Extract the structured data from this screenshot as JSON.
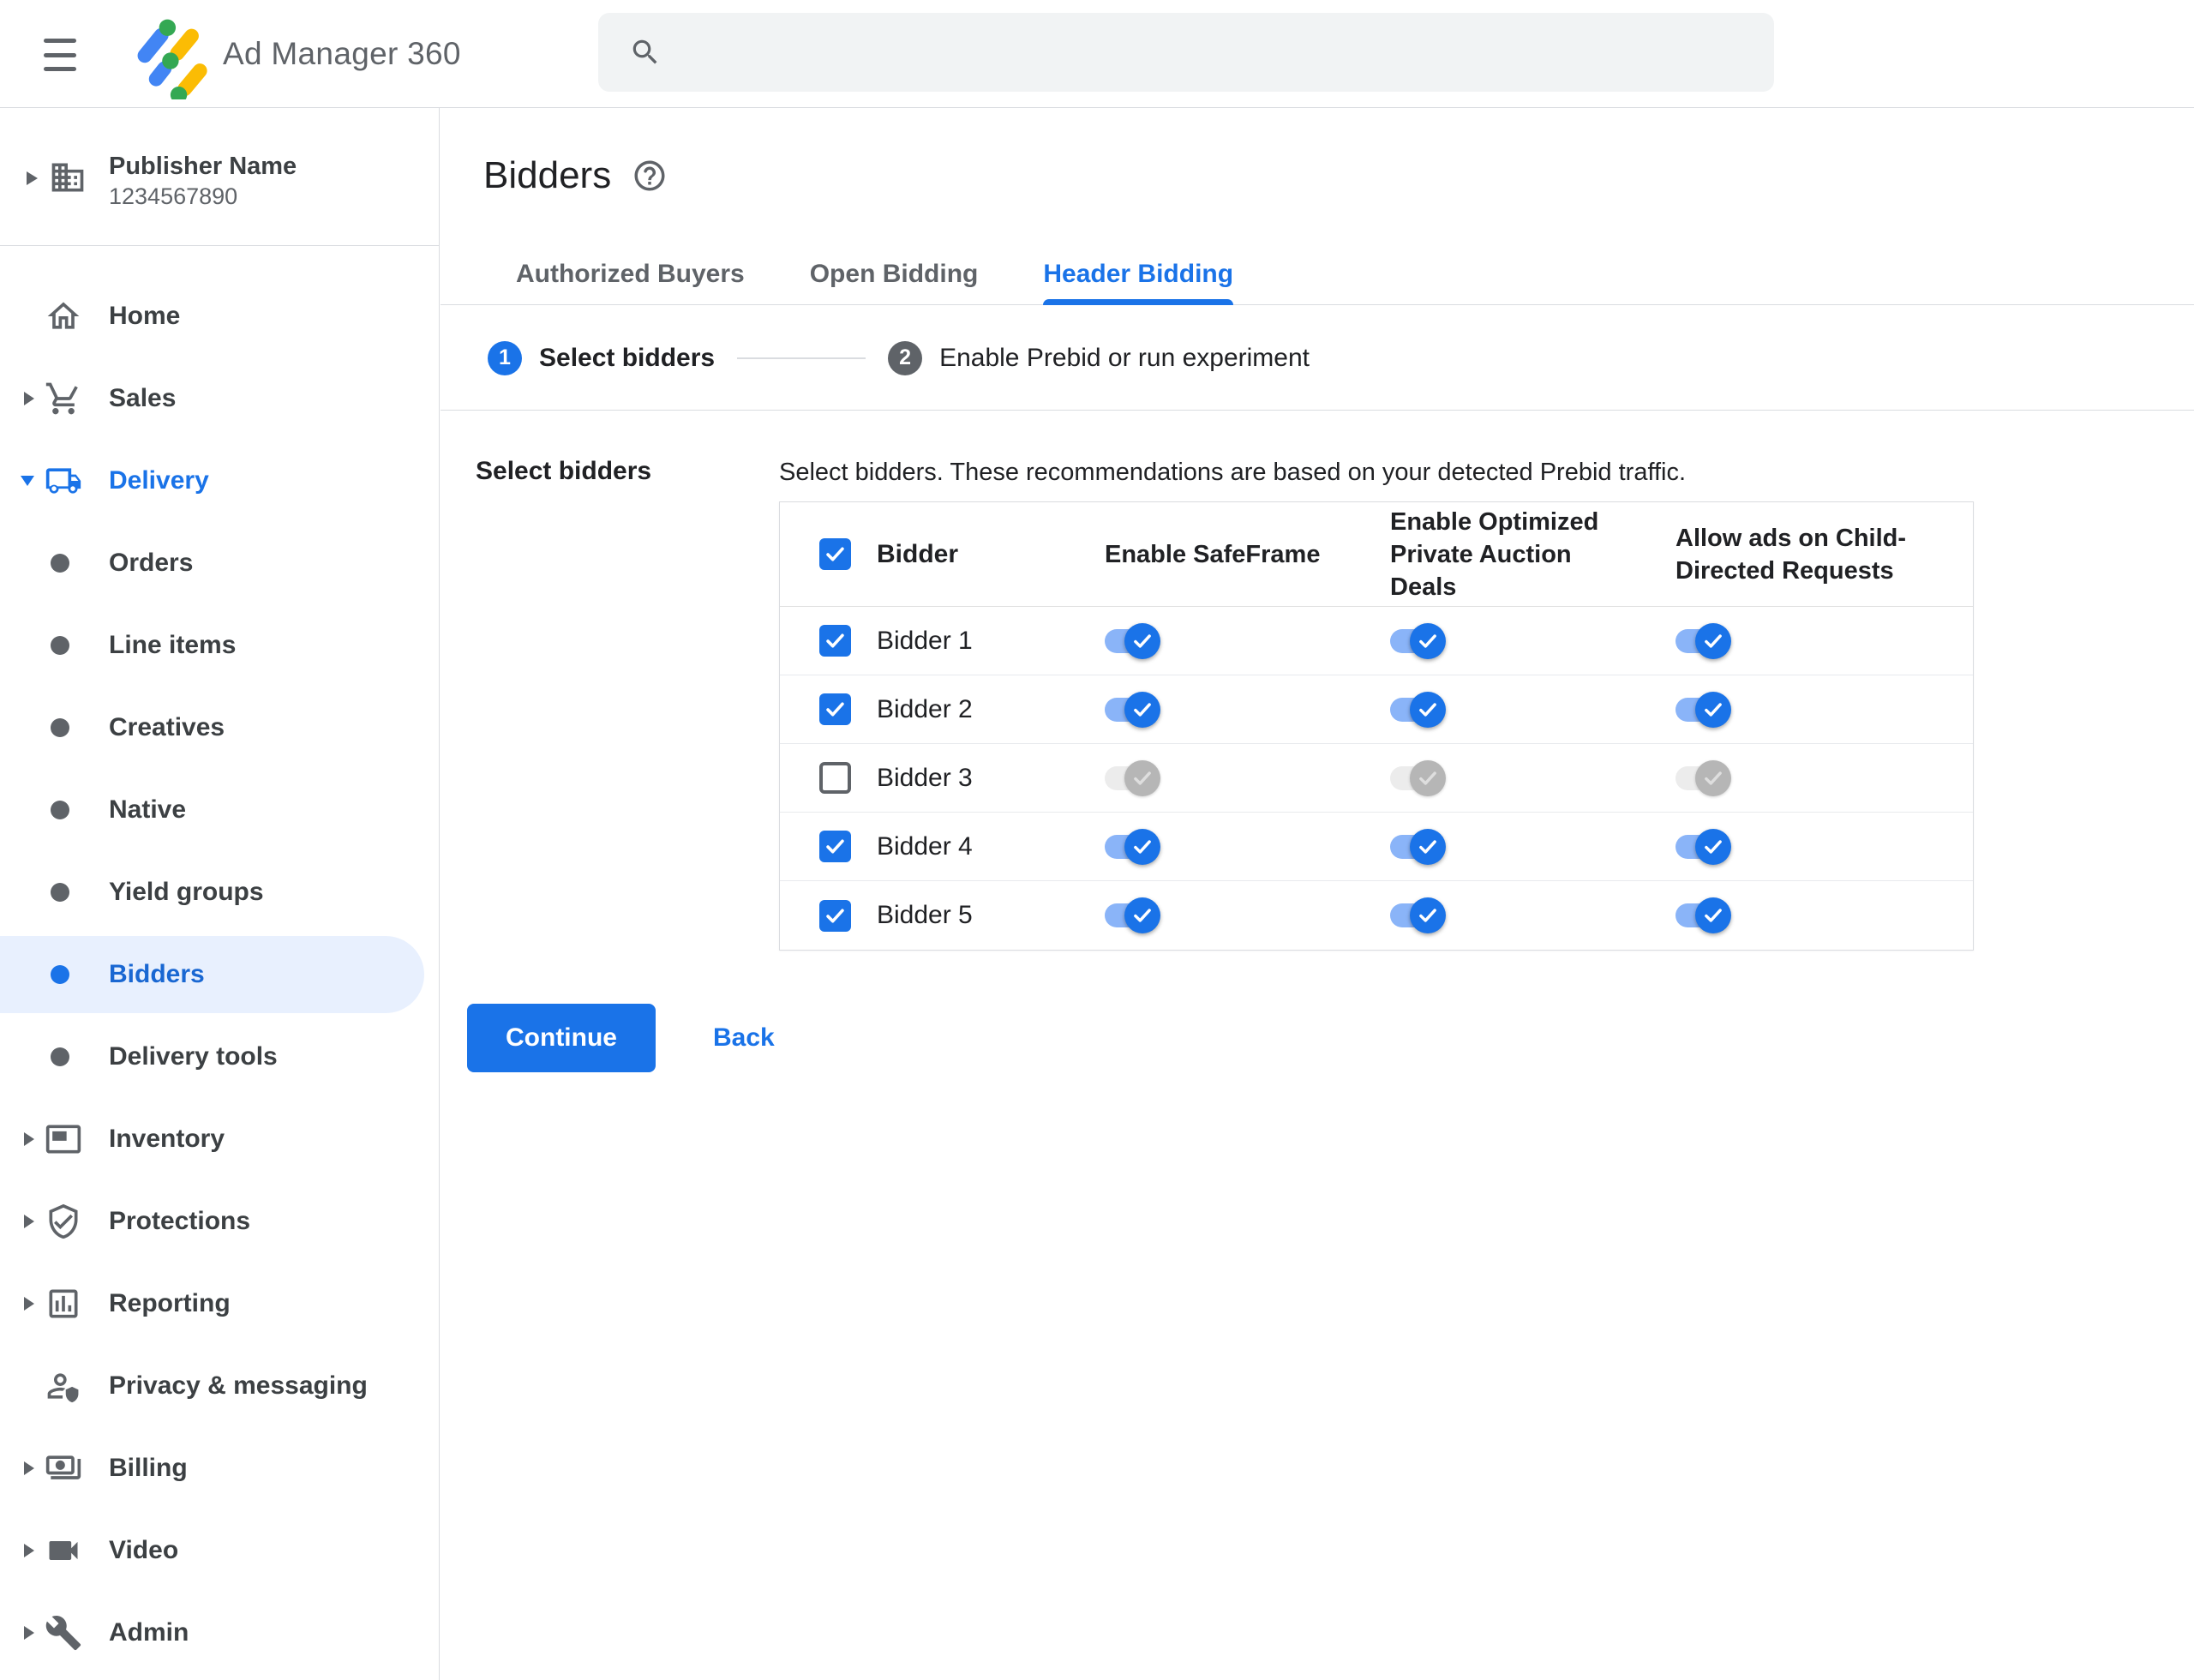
{
  "topbar": {
    "menu_icon": "hamburger-icon",
    "product_name": "Ad Manager 360",
    "search": {
      "placeholder": "",
      "value": "",
      "icon": "search-icon"
    },
    "action_icons": [
      "help-icon",
      "notifications-icon",
      "more-vertical-icon",
      "avatar"
    ]
  },
  "sidebar": {
    "publisher": {
      "name": "Publisher Name",
      "id": "1234567890",
      "icon": "building-icon"
    },
    "items": [
      {
        "label": "Home",
        "icon": "home-icon",
        "chevron": "none",
        "level": "top",
        "state": "default"
      },
      {
        "label": "Sales",
        "icon": "cart-icon",
        "chevron": "right",
        "level": "top",
        "state": "default"
      },
      {
        "label": "Delivery",
        "icon": "truck-icon",
        "chevron": "down",
        "level": "top",
        "state": "expanded-active"
      },
      {
        "label": "Orders",
        "icon": "bullet-icon",
        "chevron": "none",
        "level": "sub",
        "state": "default"
      },
      {
        "label": "Line items",
        "icon": "bullet-icon",
        "chevron": "none",
        "level": "sub",
        "state": "default"
      },
      {
        "label": "Creatives",
        "icon": "bullet-icon",
        "chevron": "none",
        "level": "sub",
        "state": "default"
      },
      {
        "label": "Native",
        "icon": "bullet-icon",
        "chevron": "none",
        "level": "sub",
        "state": "default"
      },
      {
        "label": "Yield groups",
        "icon": "bullet-icon",
        "chevron": "none",
        "level": "sub",
        "state": "default"
      },
      {
        "label": "Bidders",
        "icon": "bullet-icon",
        "chevron": "none",
        "level": "sub",
        "state": "selected"
      },
      {
        "label": "Delivery tools",
        "icon": "bullet-icon",
        "chevron": "none",
        "level": "sub",
        "state": "default"
      },
      {
        "label": "Inventory",
        "icon": "inventory-icon",
        "chevron": "right",
        "level": "top",
        "state": "default"
      },
      {
        "label": "Protections",
        "icon": "shield-icon",
        "chevron": "right",
        "level": "top",
        "state": "default"
      },
      {
        "label": "Reporting",
        "icon": "report-icon",
        "chevron": "right",
        "level": "top",
        "state": "default"
      },
      {
        "label": "Privacy & messaging",
        "icon": "privacy-icon",
        "chevron": "none",
        "level": "top",
        "state": "default"
      },
      {
        "label": "Billing",
        "icon": "billing-icon",
        "chevron": "right",
        "level": "top",
        "state": "default"
      },
      {
        "label": "Video",
        "icon": "video-icon",
        "chevron": "right",
        "level": "top",
        "state": "default"
      },
      {
        "label": "Admin",
        "icon": "admin-icon",
        "chevron": "right",
        "level": "top",
        "state": "default"
      }
    ]
  },
  "main": {
    "title": "Bidders",
    "title_help_icon": "help-icon",
    "tabs": [
      {
        "label": "Authorized Buyers",
        "active": false
      },
      {
        "label": "Open Bidding",
        "active": false
      },
      {
        "label": "Header Bidding",
        "active": true
      }
    ],
    "stepper": [
      {
        "number": "1",
        "label": "Select bidders",
        "state": "active"
      },
      {
        "number": "2",
        "label": "Enable Prebid or run experiment",
        "state": "upcoming"
      }
    ],
    "section_label": "Select bidders",
    "description": "Select bidders. These recommendations are based on your detected Prebid traffic.",
    "table": {
      "select_all_checked": true,
      "columns": [
        "Bidder",
        "Enable SafeFrame",
        "Enable Optimized Private Auction Deals",
        "Allow ads on Child-Directed Requests"
      ],
      "rows": [
        {
          "name": "Bidder 1",
          "checked": true,
          "enable_safeframe": true,
          "enable_optimized_private_auction_deals": true,
          "allow_ads_on_child_directed_requests": true,
          "toggles_enabled": true
        },
        {
          "name": "Bidder 2",
          "checked": true,
          "enable_safeframe": true,
          "enable_optimized_private_auction_deals": true,
          "allow_ads_on_child_directed_requests": true,
          "toggles_enabled": true
        },
        {
          "name": "Bidder 3",
          "checked": false,
          "enable_safeframe": true,
          "enable_optimized_private_auction_deals": true,
          "allow_ads_on_child_directed_requests": true,
          "toggles_enabled": false
        },
        {
          "name": "Bidder 4",
          "checked": true,
          "enable_safeframe": true,
          "enable_optimized_private_auction_deals": true,
          "allow_ads_on_child_directed_requests": true,
          "toggles_enabled": true
        },
        {
          "name": "Bidder 5",
          "checked": true,
          "enable_safeframe": true,
          "enable_optimized_private_auction_deals": true,
          "allow_ads_on_child_directed_requests": true,
          "toggles_enabled": true
        }
      ]
    },
    "buttons": {
      "continue": "Continue",
      "back": "Back"
    }
  },
  "colors": {
    "accent_blue": "#1a73e8",
    "selected_item_blue": "#1967d2",
    "selected_pill_bg": "#e8f0fe",
    "toggle_track_on": "#8ab4f8",
    "toggle_thumb_on": "#1a73e8",
    "toggle_track_off": "#ececec",
    "toggle_thumb_off": "#b6b6b6",
    "stepper_inactive": "#5f6368",
    "text_dark": "#202124",
    "text_gray": "#5f6368",
    "sidebar_text": "#3c4043",
    "border": "#dadce0",
    "search_bg": "#f1f3f4",
    "logo_blue": "#4285f4",
    "logo_yellow": "#fbbc04",
    "logo_green": "#34a853"
  }
}
